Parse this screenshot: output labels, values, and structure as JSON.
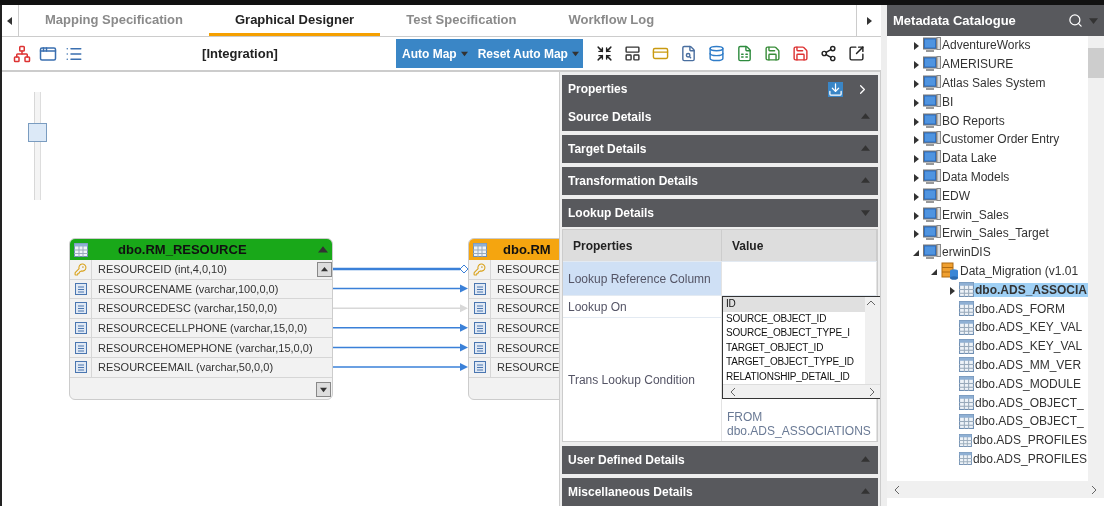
{
  "tabs": [
    {
      "label": "Mapping Specification",
      "selected": false
    },
    {
      "label": "Graphical Designer",
      "selected": true
    },
    {
      "label": "Test Specification",
      "selected": false
    },
    {
      "label": "Workflow Log",
      "selected": false
    }
  ],
  "toolbar": {
    "title": "[Integration]",
    "buttons": [
      {
        "label": "Auto Map"
      },
      {
        "label": "Reset Auto Map"
      }
    ]
  },
  "canvas": {
    "zoom_slider": {
      "level": 0.65
    },
    "source_table": {
      "title": "dbo.RM_RESOURCE",
      "columns": [
        {
          "kind": "key",
          "name": "RESOURCEID (int,4,0,10)",
          "linked": true
        },
        {
          "kind": "column",
          "name": "RESOURCENAME (varchar,100,0,0)",
          "linked": true
        },
        {
          "kind": "column",
          "name": "RESOURCEDESC (varchar,150,0,0)",
          "linked": false
        },
        {
          "kind": "column",
          "name": "RESOURCECELLPHONE (varchar,15,0,0)",
          "linked": true
        },
        {
          "kind": "column",
          "name": "RESOURCEHOMEPHONE (varchar,15,0,0)",
          "linked": true
        },
        {
          "kind": "column",
          "name": "RESOURCEEMAIL (varchar,50,0,0)",
          "linked": true
        }
      ]
    },
    "target_table": {
      "title": "dbo.RM",
      "columns": [
        {
          "kind": "key",
          "name": "RESOURCE"
        },
        {
          "kind": "column",
          "name": "RESOURCE"
        },
        {
          "kind": "column",
          "name": "RESOURCE"
        },
        {
          "kind": "column",
          "name": "RESOURCE"
        },
        {
          "kind": "column",
          "name": "RESOURCE"
        },
        {
          "kind": "column",
          "name": "RESOURCE"
        }
      ]
    }
  },
  "properties": {
    "title": "Properties",
    "sections": [
      {
        "title": "Source Details",
        "expanded": false
      },
      {
        "title": "Target Details",
        "expanded": false
      },
      {
        "title": "Transformation Details",
        "expanded": false
      },
      {
        "title": "Lookup Details",
        "expanded": true,
        "table": {
          "columns": [
            "Properties",
            "Value"
          ],
          "rows": [
            {
              "label": "Lookup Reference Column",
              "selected": true
            },
            {
              "label": "Lookup On",
              "selected": false,
              "options": [
                {
                  "label": "ID",
                  "selected": true
                },
                {
                  "label": "SOURCE_OBJECT_ID",
                  "selected": false
                },
                {
                  "label": "SOURCE_OBJECT_TYPE_I",
                  "selected": false
                },
                {
                  "label": "TARGET_OBJECT_ID",
                  "selected": false
                },
                {
                  "label": "TARGET_OBJECT_TYPE_ID",
                  "selected": false
                },
                {
                  "label": "RELATIONSHIP_DETAIL_ID",
                  "selected": false
                }
              ]
            },
            {
              "label": "Trans Lookup Condition",
              "selected": false,
              "value": "FROM dbo.ADS_ASSOCIATIONS"
            }
          ]
        }
      },
      {
        "title": "User Defined Details",
        "expanded": false
      },
      {
        "title": "Miscellaneous Details",
        "expanded": false
      }
    ]
  },
  "catalogue": {
    "title": "Metadata Catalogue",
    "tree": [
      {
        "label": "AdventureWorks",
        "kind": "system",
        "expanded": false,
        "selected": false
      },
      {
        "label": "AMERISURE",
        "kind": "system",
        "expanded": false,
        "selected": false
      },
      {
        "label": "Atlas Sales System",
        "kind": "system",
        "expanded": false,
        "selected": false
      },
      {
        "label": "BI",
        "kind": "system",
        "expanded": false,
        "selected": false
      },
      {
        "label": "BO Reports",
        "kind": "system",
        "expanded": false,
        "selected": false
      },
      {
        "label": "Customer Order Entry",
        "kind": "system",
        "expanded": false,
        "selected": false
      },
      {
        "label": "Data Lake",
        "kind": "system",
        "expanded": false,
        "selected": false
      },
      {
        "label": "Data Models",
        "kind": "system",
        "expanded": false,
        "selected": false
      },
      {
        "label": "EDW",
        "kind": "system",
        "expanded": false,
        "selected": false
      },
      {
        "label": "Erwin_Sales",
        "kind": "system",
        "expanded": false,
        "selected": false
      },
      {
        "label": "Erwin_Sales_Target",
        "kind": "system",
        "expanded": false,
        "selected": false
      },
      {
        "label": "erwinDIS",
        "kind": "system",
        "expanded": true,
        "selected": false,
        "children": [
          {
            "label": "Data_Migration (v1.01",
            "kind": "environment",
            "expanded": true,
            "selected": false,
            "children": [
              {
                "label": "dbo.ADS_ASSOCIA",
                "kind": "table",
                "expanded": false,
                "selected": true
              },
              {
                "label": "dbo.ADS_FORM",
                "kind": "table",
                "selected": false
              },
              {
                "label": "dbo.ADS_KEY_VAL",
                "kind": "table",
                "selected": false
              },
              {
                "label": "dbo.ADS_KEY_VAL",
                "kind": "table",
                "selected": false
              },
              {
                "label": "dbo.ADS_MM_VER",
                "kind": "table",
                "selected": false
              },
              {
                "label": "dbo.ADS_MODULE",
                "kind": "table",
                "selected": false
              },
              {
                "label": "dbo.ADS_OBJECT_",
                "kind": "table",
                "selected": false
              },
              {
                "label": "dbo.ADS_OBJECT_",
                "kind": "table",
                "selected": false
              },
              {
                "label": "dbo.ADS_PROFILES",
                "kind": "table",
                "selected": false
              },
              {
                "label": "dbo.ADS_PROFILES",
                "kind": "table",
                "selected": false
              }
            ]
          }
        ]
      }
    ]
  }
}
